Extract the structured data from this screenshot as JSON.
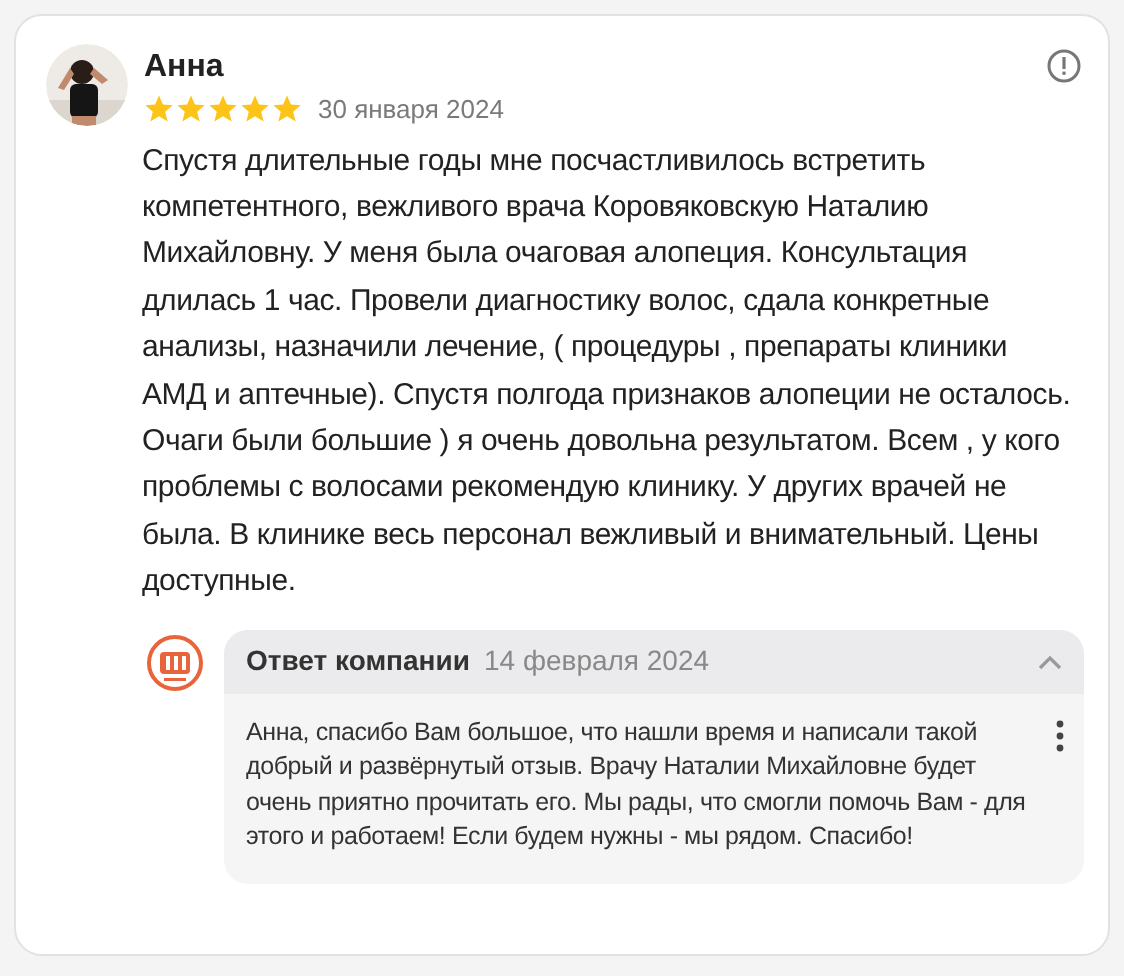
{
  "review": {
    "author": "Анна",
    "stars": 5,
    "date": "30 января 2024",
    "text": "Спустя длительные годы мне посчастливилось встретить компетентного, вежливого врача Коровяковскую Наталию Михайловну. У меня была очаговая алопеция. Консультация длилась 1 час. Провели диагностику волос, сдала конкретные анализы, назначили лечение, ( процедуры , препараты клиники АМД и аптечные). Спустя полгода признаков алопеции не осталось. Очаги были большие ) я очень довольна результатом. Всем , у кого проблемы с волосами рекомендую клинику. У других врачей не была. В клинике весь персонал вежливый и внимательный. Цены доступные."
  },
  "reply": {
    "title": "Ответ компании",
    "date": "14 февраля 2024",
    "expanded": true,
    "text": "Анна, спасибо Вам большое, что нашли время и написали такой добрый и развёрнутый отзыв. Врачу Наталии Михайловне будет очень приятно прочитать его. Мы рады, что смогли помочь Вам - для этого и работаем! Если будем нужны - мы рядом. Спасибо!"
  }
}
